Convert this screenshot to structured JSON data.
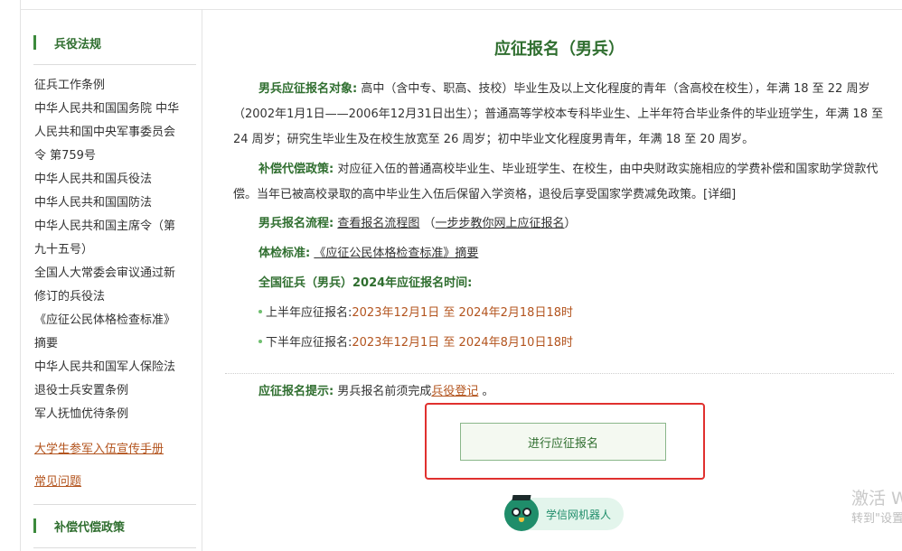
{
  "sidebar": {
    "section1_title": "兵役法规",
    "items": [
      "征兵工作条例",
      "中华人民共和国国务院 中华",
      "人民共和国中央军事委员会",
      "令 第759号",
      "中华人民共和国兵役法",
      "中华人民共和国国防法",
      "中华人民共和国主席令（第",
      "九十五号）",
      "全国人大常委会审议通过新",
      "修订的兵役法",
      "《应征公民体格检查标准》",
      "摘要",
      "中华人民共和国军人保险法",
      "退役士兵安置条例",
      "军人抚恤优待条例"
    ],
    "handbook_link": "大学生参军入伍宣传手册",
    "faq_link": "常见问题",
    "section2_title": "补偿代偿政策"
  },
  "main": {
    "title": "应征报名（男兵）",
    "target_label": "男兵应征报名对象:",
    "target_text": " 高中（含中专、职高、技校）毕业生及以上文化程度的青年（含高校在校生），年满 18 至 22 周岁（2002年1月1日——2006年12月31日出生）；普通高等学校本专科毕业生、上半年符合毕业条件的毕业班学生，年满 18 至 24 周岁；研究生毕业生及在校生放宽至 26 周岁；初中毕业文化程度男青年，年满 18 至 20 周岁。",
    "policy_label": "补偿代偿政策:",
    "policy_text": " 对应征入伍的普通高校毕业生、毕业班学生、在校生，由中央财政实施相应的学费补偿和国家助学贷款代偿。当年已被高校录取的高中毕业生入伍后保留入学资格，退役后享受国家学费减免政策。",
    "policy_detail_link": "[详细]",
    "process_label": "男兵报名流程:",
    "process_link": "查看报名流程图",
    "process_paren_open": "（",
    "process_step_link": "一步步教你网上应征报名",
    "process_paren_close": "）",
    "standard_label": "体检标准:",
    "standard_link": "《应征公民体格检查标准》摘要",
    "time_heading": "全国征兵（男兵）2024年应征报名时间:",
    "first_half_label": "上半年应征报名:",
    "first_half_time": "2023年12月1日 至 2024年2月18日18时",
    "second_half_label": "下半年应征报名:",
    "second_half_time": "2023年12月1日 至 2024年8月10日18时",
    "tip_label": "应征报名提示:",
    "tip_text": " 男兵报名前须完成",
    "tip_link": "兵役登记",
    "tip_end": " 。",
    "apply_button": "进行应征报名",
    "robot_label": "学信网机器人"
  },
  "watermark": {
    "line1": "激活 W",
    "line2": "转到\"设置"
  },
  "colors": {
    "accent_green": "#2f6e2f",
    "link_red": "#b3541e",
    "highlight_box": "#e0302e"
  }
}
